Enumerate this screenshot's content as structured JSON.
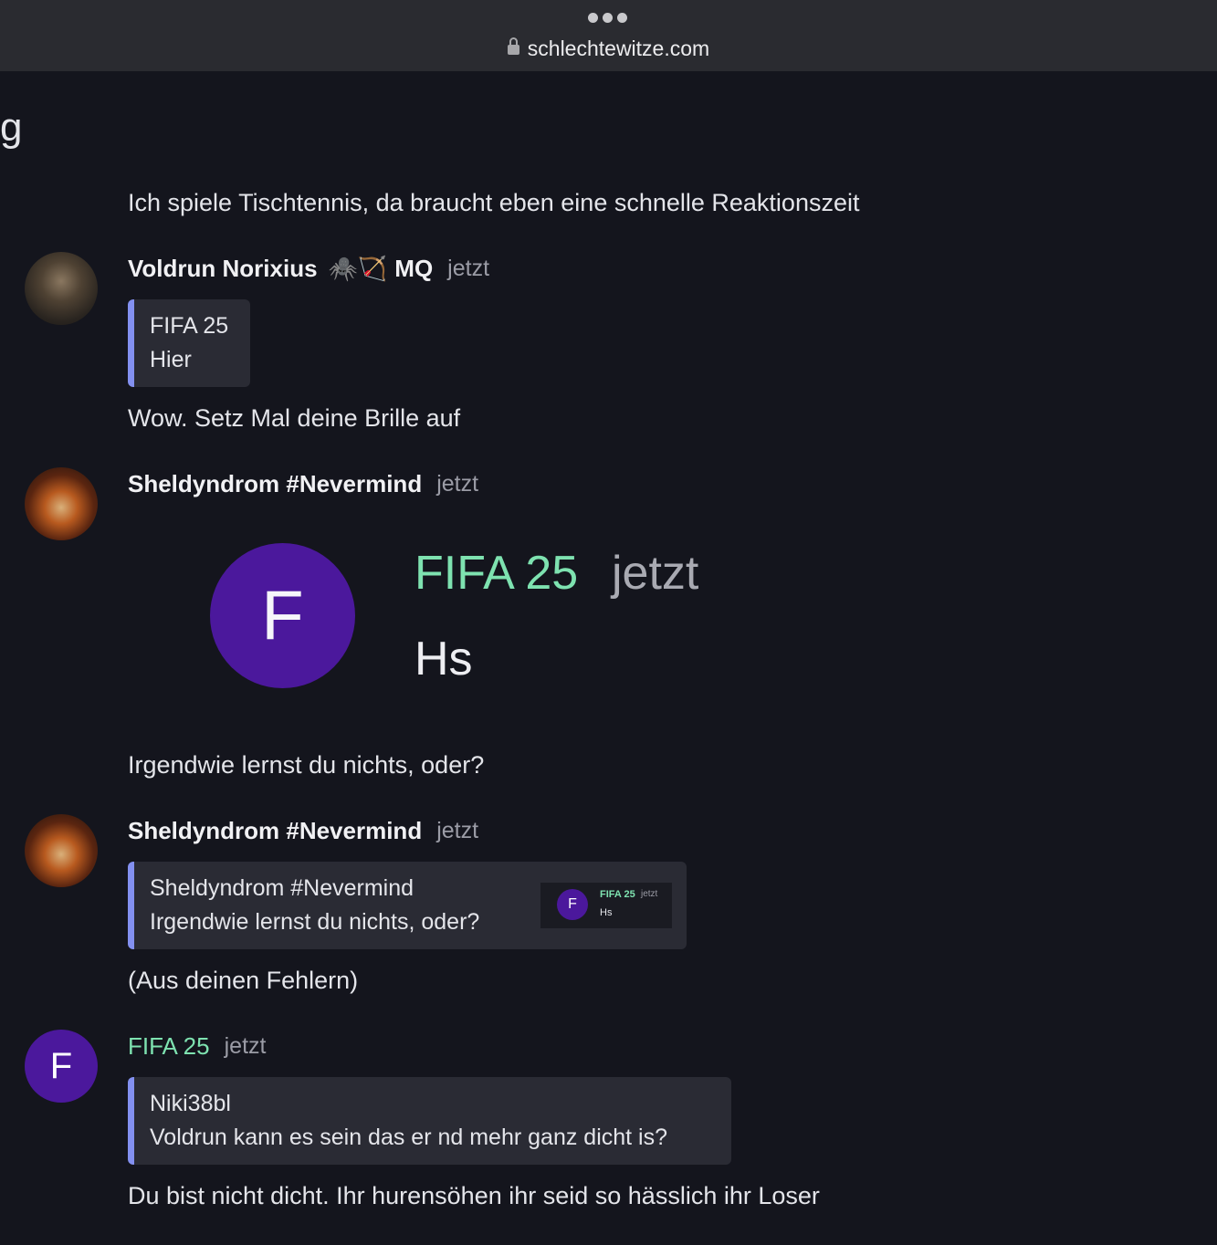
{
  "browser": {
    "url": "schlechtewitze.com"
  },
  "edge_fragment": "g",
  "messages": [
    {
      "text": "Ich spiele Tischtennis, da braucht eben eine schnelle Reaktionszeit"
    },
    {
      "author": "Voldrun Norixius",
      "badges": "🕷️🏹",
      "tag": "MQ",
      "time": "jetzt",
      "avatar": "fantasy-warrior-avatar",
      "reply_to": {
        "author": "FIFA 25",
        "text": "Hier"
      },
      "text": "Wow. Setz Mal deine Brille auf"
    },
    {
      "author": "Sheldyndrom #Nevermind",
      "time": "jetzt",
      "avatar": "winged-figure-fire-avatar",
      "embed": {
        "avatar_letter": "F",
        "author": "FIFA 25",
        "time": "jetzt",
        "text": "Hs"
      },
      "text": "Irgendwie lernst du nichts, oder?"
    },
    {
      "author": "Sheldyndrom #Nevermind",
      "time": "jetzt",
      "avatar": "winged-figure-fire-avatar",
      "reply_to": {
        "author": "Sheldyndrom #Nevermind",
        "text": "Irgendwie lernst du nichts, oder?",
        "thumbnail": {
          "avatar_letter": "F",
          "author": "FIFA 25",
          "time": "jetzt",
          "text": "Hs"
        }
      },
      "text": "(Aus deinen Fehlern)"
    },
    {
      "author": "FIFA 25",
      "time": "jetzt",
      "avatar_letter": "F",
      "reply_to": {
        "author": "Niki38bl",
        "text": "Voldrun kann es sein das er nd mehr ganz dicht is?"
      },
      "text": "Du bist nicht dicht. Ihr hurensöhen ihr seid so hässlich ihr Loser"
    }
  ],
  "colors": {
    "background": "#14151d",
    "quote_bar": "#8390f0",
    "quote_bg": "#2a2b34",
    "avatar_purple": "#4b189c",
    "name_green": "#7ee2b0"
  }
}
